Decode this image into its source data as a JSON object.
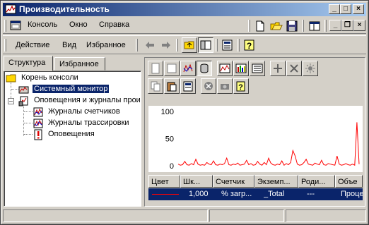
{
  "window": {
    "title": "Производительность"
  },
  "menu": {
    "console": "Консоль",
    "window": "Окно",
    "help": "Справка"
  },
  "actionbar": {
    "action": "Действие",
    "view": "Вид",
    "favorites": "Избранное"
  },
  "tabs": {
    "tree": "Структура",
    "favorites": "Избранное"
  },
  "tree": {
    "root": "Корень консоли",
    "system_monitor": "Системный монитор",
    "alerts_logs": "Оповещения и журналы прои",
    "counter_logs": "Журналы счетчиков",
    "trace_logs": "Журналы трассировки",
    "alerts": "Оповещения"
  },
  "legend": {
    "headers": [
      "Цвет",
      "Шк...",
      "Счетчик",
      "Экземп...",
      "Роди...",
      "Объе"
    ],
    "row": {
      "scale": "1,000",
      "counter": "% загр...",
      "instance": "_Total",
      "parent": "---",
      "object": "Проце"
    }
  },
  "colors": {
    "series": "#ff0000",
    "selection": "#0a246a"
  },
  "chart_data": {
    "type": "line",
    "yticks": [
      "100",
      "50",
      "0"
    ],
    "ylim": [
      0,
      100
    ],
    "grid": false,
    "series": [
      {
        "values": [
          3,
          1,
          2,
          8,
          2,
          1,
          4,
          2,
          12,
          3,
          1,
          2,
          1,
          6,
          3,
          2,
          9,
          2,
          1,
          3,
          2,
          4,
          14,
          2,
          1,
          3,
          2,
          5,
          1,
          2,
          3,
          10,
          2,
          4,
          1,
          2,
          8,
          3,
          1,
          6,
          2,
          14,
          5,
          2,
          1,
          3,
          2,
          9,
          1,
          4,
          2,
          6,
          28,
          18,
          3,
          1,
          2,
          6,
          12,
          3,
          2,
          1,
          5,
          3,
          2,
          10,
          2,
          1,
          4,
          3,
          2,
          1,
          18,
          3,
          1,
          2,
          4,
          2,
          1,
          3,
          1,
          80,
          3
        ]
      }
    ]
  }
}
